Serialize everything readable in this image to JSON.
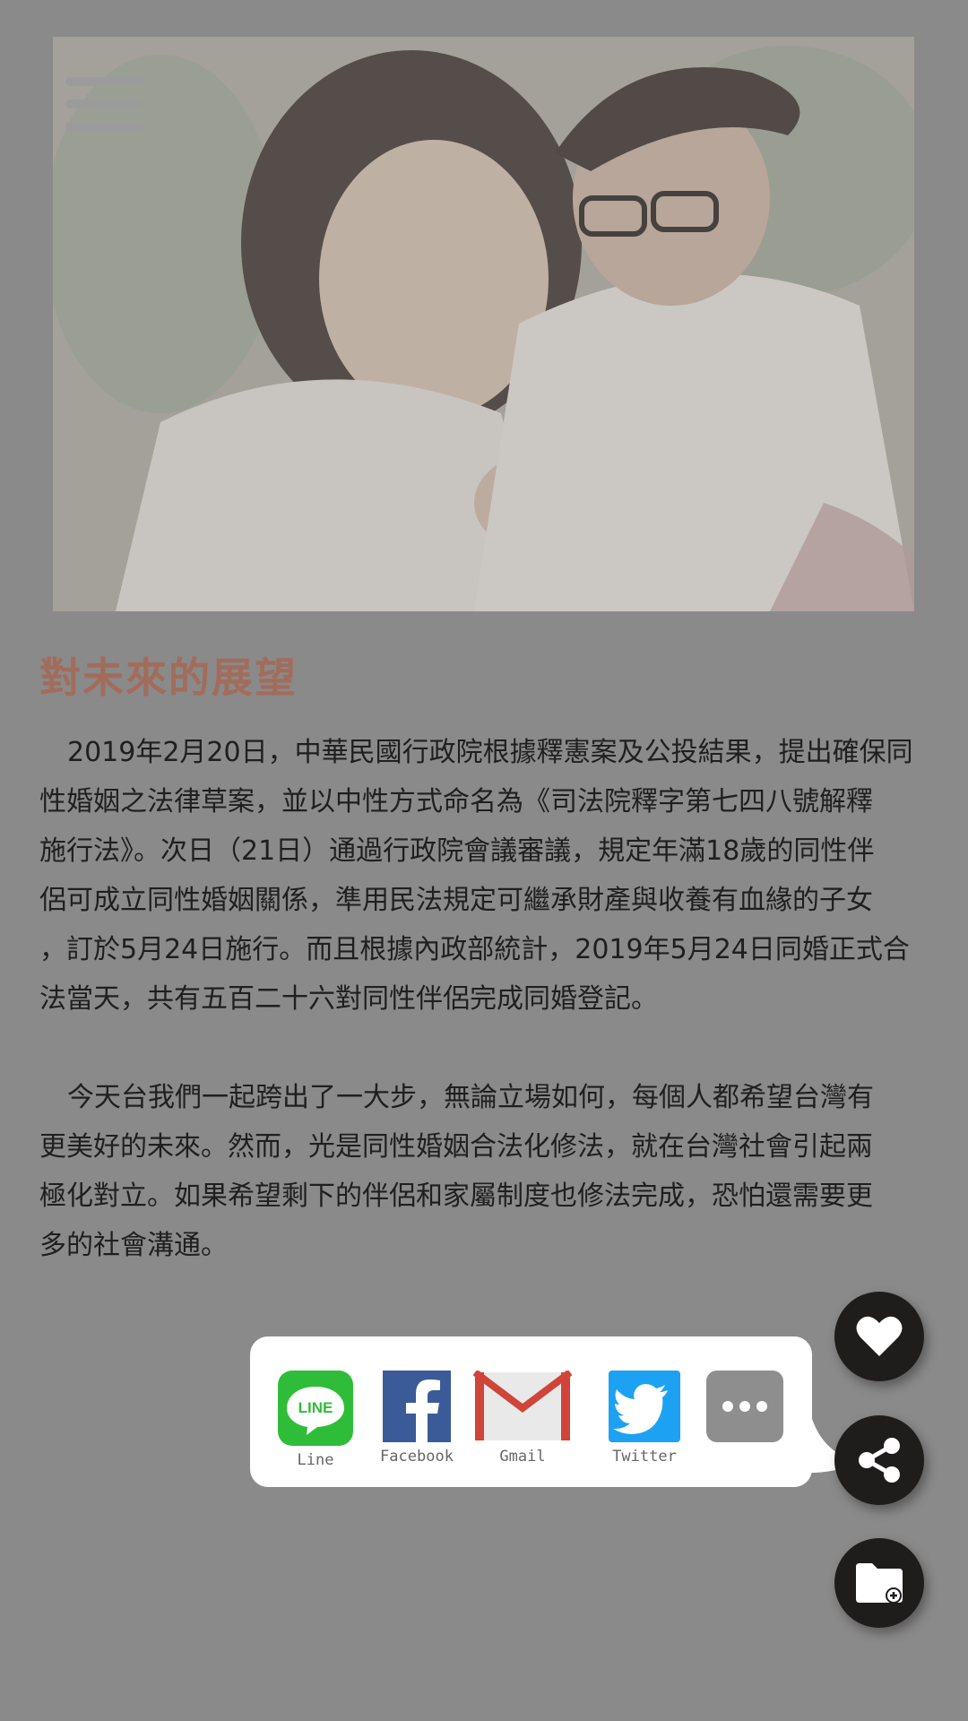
{
  "header": {
    "menu_icon": "hamburger-icon"
  },
  "article": {
    "title": "對未來的展望",
    "paragraph1_lines": [
      "2019年2月20日，中華民國行政院根據釋憲案及公投結果，提出確保同",
      "性婚姻之法律草案，並以中性方式命名為《司法院釋字第七四八號解釋",
      "施行法》。次日（21日）通過行政院會議審議，規定年滿18歲的同性伴",
      "侶可成立同性婚姻關係，準用民法規定可繼承財產與收養有血緣的子女",
      "，訂於5月24日施行。而且根據內政部統計，2019年5月24日同婚正式合",
      "法當天，共有五百二十六對同性伴侶完成同婚登記。"
    ],
    "paragraph2_lines": [
      "今天台我們一起跨出了一大步，無論立場如何，每個人都希望台灣有",
      "更美好的未來。然而，光是同性婚姻合法化修法，就在台灣社會引起兩",
      "極化對立。如果希望剩下的伴侶和家屬制度也修法完成，恐怕還需要更",
      "多的社會溝通。"
    ]
  },
  "share": {
    "items": [
      {
        "label": "Line",
        "icon": "line-icon",
        "color": "#2fbd39"
      },
      {
        "label": "Facebook",
        "icon": "facebook-icon",
        "color": "#3b5a98"
      },
      {
        "label": "Gmail",
        "icon": "gmail-icon",
        "color": "#d0443a"
      },
      {
        "label": "Twitter",
        "icon": "twitter-icon",
        "color": "#1da1f2"
      },
      {
        "label": "",
        "icon": "more-icon",
        "color": "#8e8e8e"
      }
    ]
  },
  "fabs": {
    "like_icon": "heart-icon",
    "share_icon": "share-icon",
    "folder_icon": "folder-add-icon",
    "background": "#1f1c1c"
  },
  "colors": {
    "overlay_gray": "#8a8a8a",
    "title_color": "#a26c5b"
  }
}
